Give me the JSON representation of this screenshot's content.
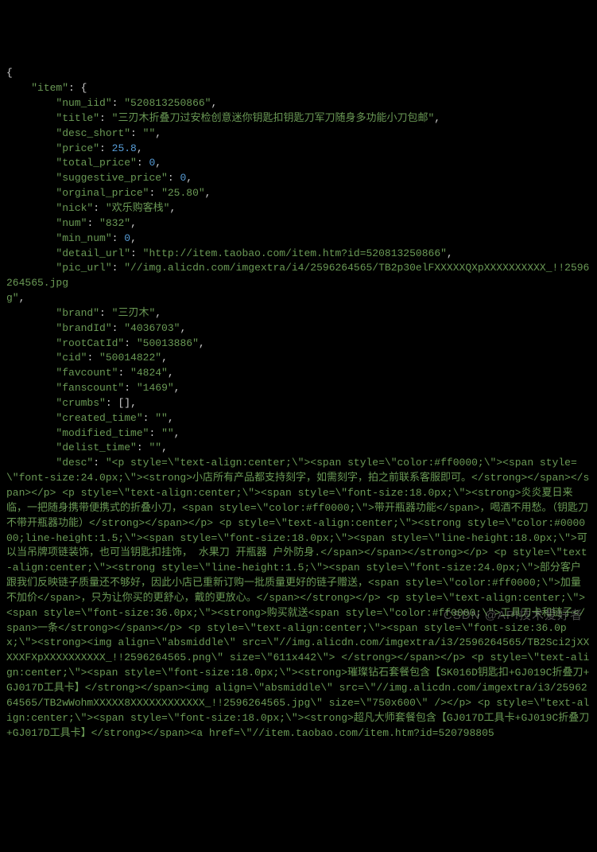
{
  "json_display": {
    "item": {
      "num_iid": "520813250866",
      "title": "三刃木折叠刀过安检创意迷你钥匙扣钥匙刀军刀随身多功能小刀包邮",
      "desc_short": "",
      "price": 25.8,
      "total_price": 0,
      "suggestive_price": 0,
      "orginal_price": "25.80",
      "nick": "欢乐购客栈",
      "num": "832",
      "min_num": 0,
      "detail_url": "http://item.taobao.com/item.htm?id=520813250866",
      "pic_url": "//img.alicdn.com/imgextra/i4/2596264565/TB2p30elFXXXXXQXpXXXXXXXXXX_!!2596264565.jpg",
      "brand": "三刃木",
      "brandId": "4036703",
      "rootCatId": "50013886",
      "cid": "50014822",
      "favcount": "4824",
      "fanscount": "1469",
      "crumbs": [],
      "created_time": "",
      "modified_time": "",
      "delist_time": "",
      "desc": "<p style=\\\"text-align:center;\\\"><span style=\\\"color:#ff0000;\\\"><span style=\\\"font-size:24.0px;\\\"><strong>小店所有产品都支持刻字，如需刻字，拍之前联系客服即可。</strong></span></span></p> <p style=\\\"text-align:center;\\\"><span style=\\\"font-size:18.0px;\\\"><strong>炎炎夏日来临，一把随身携带便携式的折叠小刀，<span style=\\\"color:#ff0000;\\\">带开瓶器功能</span>，喝酒不用愁。（钥匙刀不带开瓶器功能）</strong></span></p> <p style=\\\"text-align:center;\\\"><strong style=\\\"color:#000000;line-height:1.5;\\\"><span style=\\\"font-size:18.0px;\\\"><span style=\\\"line-height:18.0px;\\\">可以当吊牌项链装饰，也可当钥匙扣挂饰， 水果刀 开瓶器 户外防身.</span></span></strong></p> <p style=\\\"text-align:center;\\\"><strong style=\\\"line-height:1.5;\\\"><span style=\\\"font-size:24.0px;\\\">部分客户跟我们反映链子质量还不够好，因此小店已重新订购一批质量更好的链子赠送，<span style=\\\"color:#ff0000;\\\">加量不加价</span>，只为让你买的更舒心，戴的更放心。</span></strong></p> <p style=\\\"text-align:center;\\\"><span style=\\\"font-size:36.0px;\\\"><strong>购买就送<span style=\\\"color:#ff0000;\\\">工具刀卡和链子</span>一条</strong></span></p> <p style=\\\"text-align:center;\\\"><span style=\\\"font-size:36.0px;\\\"><strong><img align=\\\"absmiddle\\\" src=\\\"//img.alicdn.com/imgextra/i3/2596264565/TB2Sci2jXXXXXFXpXXXXXXXXXX_!!2596264565.png\\\" size=\\\"611x442\\\"> </strong></span></p> <p style=\\\"text-align:center;\\\"><span style=\\\"font-size:18.0px;\\\"><strong>璀璨钻石套餐包含【SK016D钥匙扣+GJ019C折叠刀+GJ017D工具卡】</strong></span><img align=\\\"absmiddle\\\" src=\\\"//img.alicdn.com/imgextra/i3/2596264565/TB2wWohmXXXXX8XXXXXXXXXXXX_!!2596264565.jpg\\\" size=\\\"750x600\\\" /></p> <p style=\\\"text-align:center;\\\"><span style=\\\"font-size:18.0px;\\\"><strong>超凡大师套餐包含【GJ017D工具卡+GJ019C折叠刀+GJ017D工具卡】</strong></span><a href=\\\"//item.taobao.com/item.htm?id=520798805"
    }
  },
  "watermark": "CSDN @API技术爱好者"
}
